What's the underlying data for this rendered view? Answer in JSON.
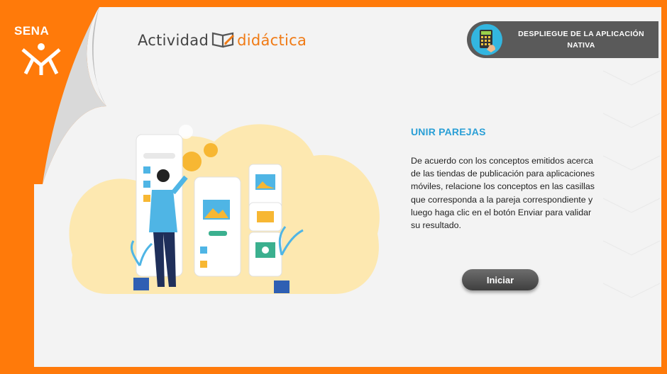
{
  "logo": {
    "text": "SENA",
    "icon": "sena-logo-icon"
  },
  "header": {
    "title_part1": "Actividad",
    "title_part2": "didáctica",
    "book_icon": "book-pencil-icon"
  },
  "badge": {
    "text": "DESPLIEGUE DE LA APLICACIÓN NATIVA",
    "icon": "calculator-hand-icon"
  },
  "activity": {
    "title": "UNIR PAREJAS",
    "description": "De acuerdo con los conceptos emitidos acerca de las tiendas de publicación para aplicaciones móviles, relacione los conceptos en las casillas que corresponda a la pareja correspondiente y luego haga clic en el botón Enviar para validar su resultado."
  },
  "buttons": {
    "start": "Iniciar"
  },
  "colors": {
    "frame": "#ff7a0a",
    "panel": "#f3f3f3",
    "accent_blue": "#2a9fd6",
    "badge_bg": "#5a5a5a",
    "cloud": "#fde8b0"
  }
}
